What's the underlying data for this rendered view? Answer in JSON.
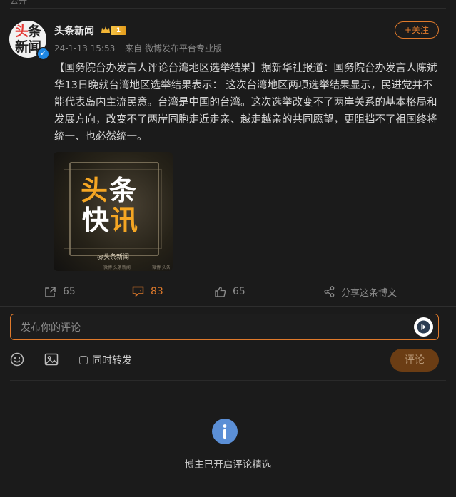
{
  "top": {
    "partial_text": "公开"
  },
  "author": {
    "name": "头条新闻",
    "avatar_line1_a": "头",
    "avatar_line1_b": "条",
    "avatar_line2": "新闻",
    "level_badge": "1",
    "verified": true
  },
  "post": {
    "date": "24-1-13 15:53",
    "source": "来自 微博发布平台专业版",
    "follow_label": "+关注",
    "text": "【国务院台办发言人评论台湾地区选举结果】据新华社报道：国务院台办发言人陈斌华13日晚就台湾地区选举结果表示： 这次台湾地区两项选举结果显示，民进党并不能代表岛内主流民意。台湾是中国的台湾。这次选举改变不了两岸关系的基本格局和发展方向，改变不了两岸同胞走近走亲、越走越亲的共同愿望，更阻挡不了祖国终将统一、也必然统一。",
    "image": {
      "title_line1_a": "头",
      "title_line1_b": "条",
      "title_line2_a": "快",
      "title_line2_b": "讯",
      "handle": "@头条新闻",
      "watermark1": "微博 头条新闻",
      "watermark2": "微博 头条新闻"
    }
  },
  "actions": {
    "repost_count": "65",
    "comment_count": "83",
    "like_count": "65",
    "share_label": "分享这条博文"
  },
  "composer": {
    "placeholder": "发布你的评论",
    "repost_checkbox_label": "同时转发",
    "submit_label": "评论"
  },
  "notice": {
    "text": "博主已开启评论精选"
  },
  "colors": {
    "accent": "#e07a2b",
    "info": "#5b8fd6",
    "verified": "#1e88e5"
  }
}
